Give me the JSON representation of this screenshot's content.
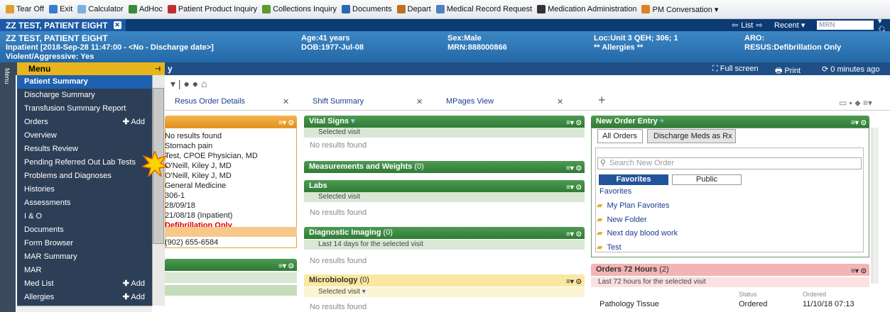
{
  "toolbar": [
    "Tear Off",
    "Exit",
    "Calculator",
    "AdHoc",
    "Patient Product Inquiry",
    "Collections Inquiry",
    "Documents",
    "Depart",
    "Medical Record Request",
    "Medication Administration",
    "PM Conversation ▾"
  ],
  "title": {
    "patient_tab": "ZZ TEST, PATIENT EIGHT",
    "list": "List",
    "recent": "Recent ▾",
    "mrn_placeholder": "MRN"
  },
  "banner": {
    "name": "ZZ TEST, PATIENT EIGHT",
    "encounter": "Inpatient [2018-Sep-28 11:47:00 - <No - Discharge date>]",
    "violent": "Violent/Aggressive: Yes",
    "age": "Age:41 years",
    "dob": "DOB:1977-Jul-08",
    "sex": "Sex:Male",
    "mrn": "MRN:888000866",
    "loc": "Loc:Unit 3 QEH; 306; 1",
    "allergies": "** Allergies **",
    "aro": "ARO:",
    "resus": "RESUS:Defibrillation Only"
  },
  "subheader": {
    "menu": "Menu",
    "fullscreen": "Full screen",
    "print": "Print",
    "refresh": "0 minutes ago",
    "page_tail": "y"
  },
  "menu": [
    {
      "label": "Patient Summary",
      "sel": true
    },
    {
      "label": "Discharge Summary"
    },
    {
      "label": "Transfusion Summary Report"
    },
    {
      "label": "Orders",
      "add": "Add"
    },
    {
      "label": "Overview"
    },
    {
      "label": "Results Review"
    },
    {
      "label": "Pending Referred Out Lab Tests"
    },
    {
      "label": "Problems and Diagnoses"
    },
    {
      "label": "Histories"
    },
    {
      "label": "Assessments"
    },
    {
      "label": "I & O"
    },
    {
      "label": "Documents"
    },
    {
      "label": "Form Browser"
    },
    {
      "label": "MAR Summary"
    },
    {
      "label": "MAR"
    },
    {
      "label": "Med List",
      "add": "Add"
    },
    {
      "label": "Allergies",
      "add": "Add"
    }
  ],
  "tabs": [
    "Resus Order Details",
    "Shift Summary",
    "MPages View"
  ],
  "left_panel": [
    "No results found",
    "Stomach pain",
    "Test, CPOE Physician, MD",
    "O'Neill, Kiley J, MD",
    "O'Neill, Kiley J, MD",
    "General Medicine",
    "306-1",
    "28/09/18",
    "21/08/18 (Inpatient)",
    "Defibrillation Only",
    "(902) 655-6584"
  ],
  "mid": {
    "vital": "Vital Signs",
    "selected_visit": "Selected visit",
    "no_results": "No results found",
    "meas": "Measurements and Weights",
    "meas_count": "(0)",
    "labs": "Labs",
    "diag": "Diagnostic Imaging",
    "diag_count": "(0)",
    "last14": "Last 14 days for the selected visit",
    "micro": "Microbiology",
    "micro_count": "(0)"
  },
  "right": {
    "noe": "New Order Entry",
    "all_orders": "All Orders",
    "discharge_meds": "Discharge Meds as Rx",
    "search": "Search New Order",
    "favorites_tab": "Favorites",
    "public_tab": "Public",
    "favorites_link": "Favorites",
    "folders": [
      "My Plan Favorites",
      "New Folder",
      "Next day blood work",
      "Test"
    ],
    "orders72": "Orders 72 Hours",
    "orders72_count": "(2)",
    "last72": "Last 72 hours for the selected visit",
    "col_status": "Status",
    "col_ordered": "Ordered",
    "row_name": "Pathology Tissue",
    "row_status": "Ordered",
    "row_date": "11/10/18 07:13"
  }
}
